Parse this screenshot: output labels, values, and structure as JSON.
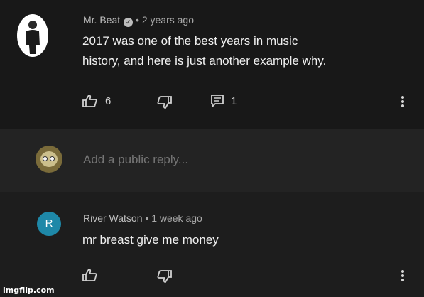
{
  "top_comment": {
    "author": "Mr. Beat",
    "separator": "•",
    "time": "2 years ago",
    "text_line1": "2017 was one of the best years in music",
    "text_line2": "history, and here is just another example why.",
    "likes": "6",
    "replies": "1"
  },
  "reply_box": {
    "placeholder": "Add a public reply..."
  },
  "second_comment": {
    "avatar_letter": "R",
    "author": "River Watson",
    "separator": "•",
    "time": "1 week ago",
    "text": "mr breast give me  money"
  },
  "watermark": "imgflip.com",
  "colors": {
    "background": "#1c1c1c",
    "reply_avatar": "#1e88a8"
  }
}
